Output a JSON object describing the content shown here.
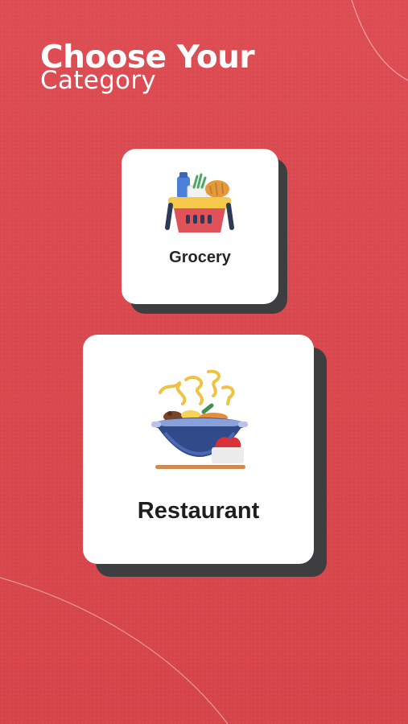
{
  "header": {
    "title_line1": "Choose Your",
    "title_line2": "Category"
  },
  "categories": [
    {
      "label": "Grocery",
      "icon": "grocery-basket-icon"
    },
    {
      "label": "Restaurant",
      "icon": "restaurant-food-pot-icon"
    }
  ],
  "colors": {
    "background": "#d8474d",
    "card": "#ffffff",
    "card_shadow": "#3e3d40",
    "text_light": "#ffffff",
    "text_dark": "#1e1e1e"
  }
}
